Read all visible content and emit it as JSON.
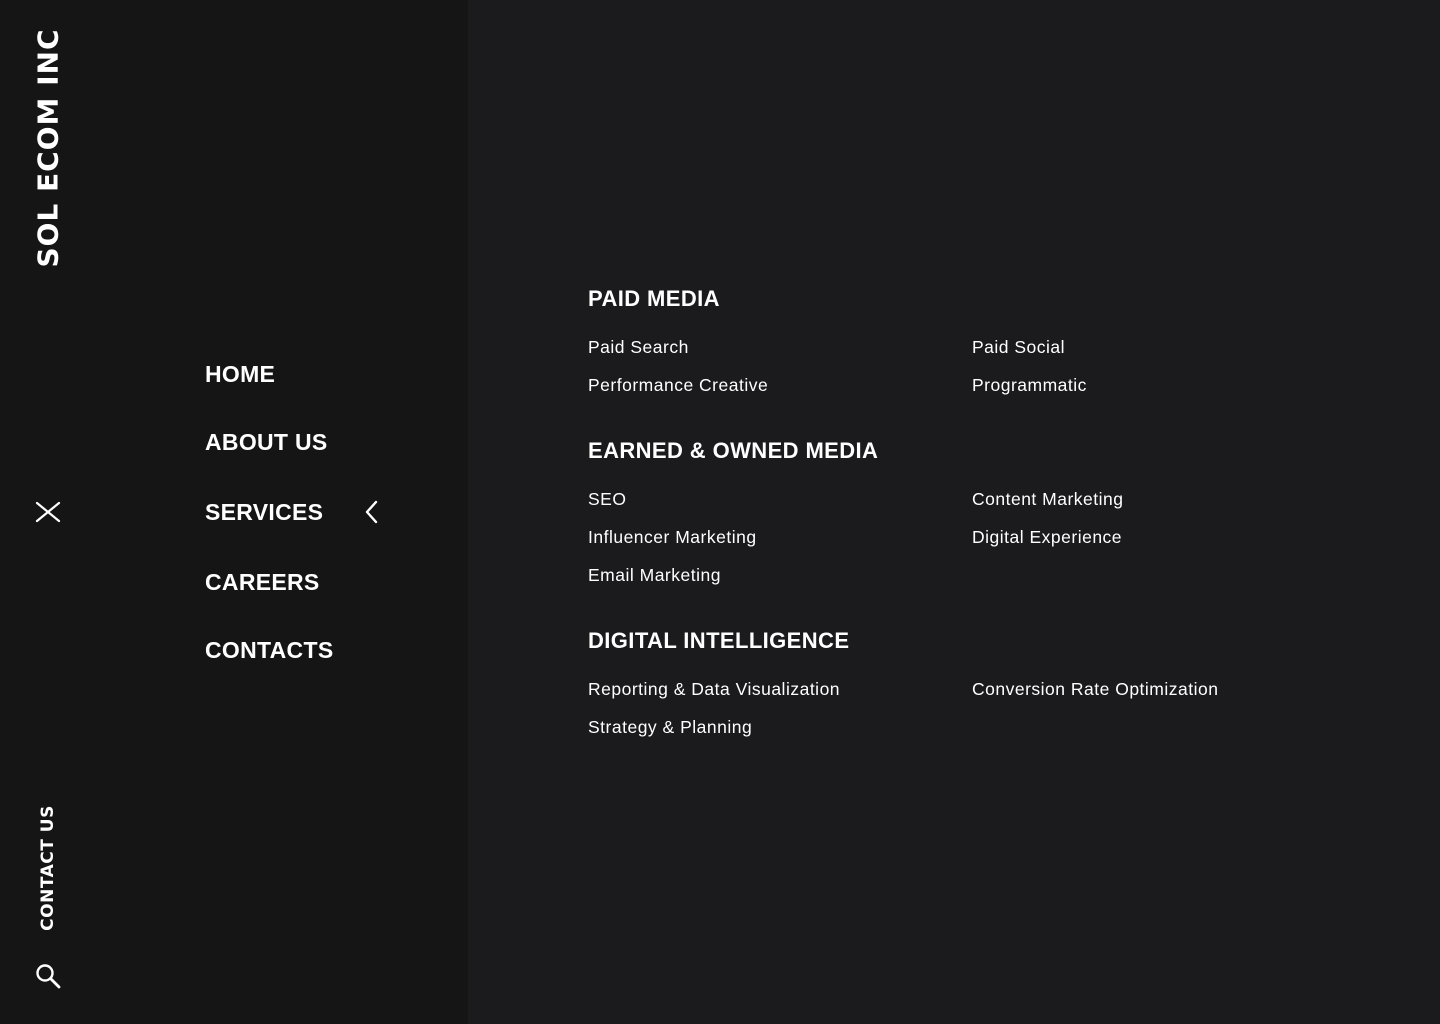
{
  "brand": {
    "name": "SOL ECOM INC"
  },
  "sidebar": {
    "contact_label": "CONTACT US",
    "close_icon": "close-icon",
    "search_icon": "search-icon"
  },
  "nav": {
    "items": [
      {
        "label": "HOME"
      },
      {
        "label": "ABOUT US"
      },
      {
        "label": "SERVICES",
        "expanded": true,
        "icon": "chevron-left-icon"
      },
      {
        "label": "CAREERS"
      },
      {
        "label": "CONTACTS"
      }
    ]
  },
  "services": {
    "paid_media": {
      "title": "PAID MEDIA",
      "links": [
        "Paid Search",
        "Paid Social",
        "Performance Creative",
        "Programmatic"
      ]
    },
    "earned_owned": {
      "title": "EARNED & OWNED MEDIA",
      "links": [
        "SEO",
        "Content Marketing",
        "Influencer Marketing",
        "Digital Experience",
        "Email Marketing"
      ]
    },
    "digital_intelligence": {
      "title": "DIGITAL INTELLIGENCE",
      "links": [
        "Reporting & Data Visualization",
        "Conversion Rate Optimization",
        "Strategy & Planning"
      ]
    }
  },
  "colors": {
    "left_panel_bg": "#151515",
    "right_panel_bg": "#1b1b1d",
    "text": "#ffffff"
  }
}
